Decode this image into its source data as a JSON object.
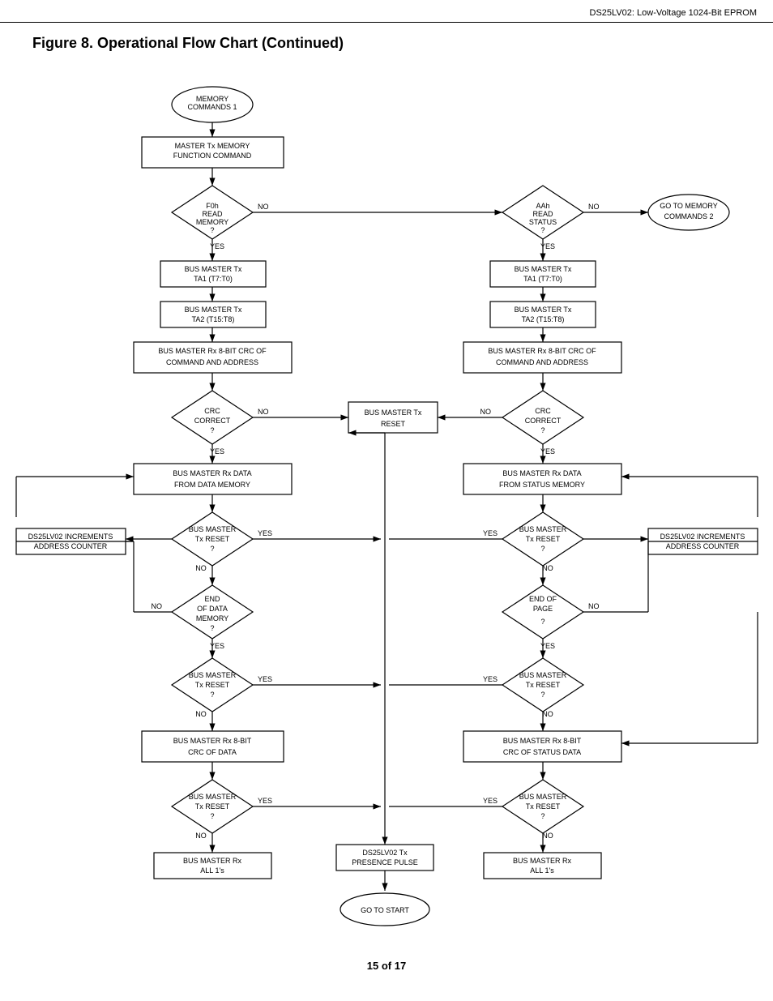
{
  "header": {
    "title": "DS25LV02: Low-Voltage 1024-Bit EPROM"
  },
  "page_title": "Figure 8. Operational Flow Chart (Continued)",
  "footer": "15 of 17",
  "flowchart": {
    "nodes": []
  }
}
